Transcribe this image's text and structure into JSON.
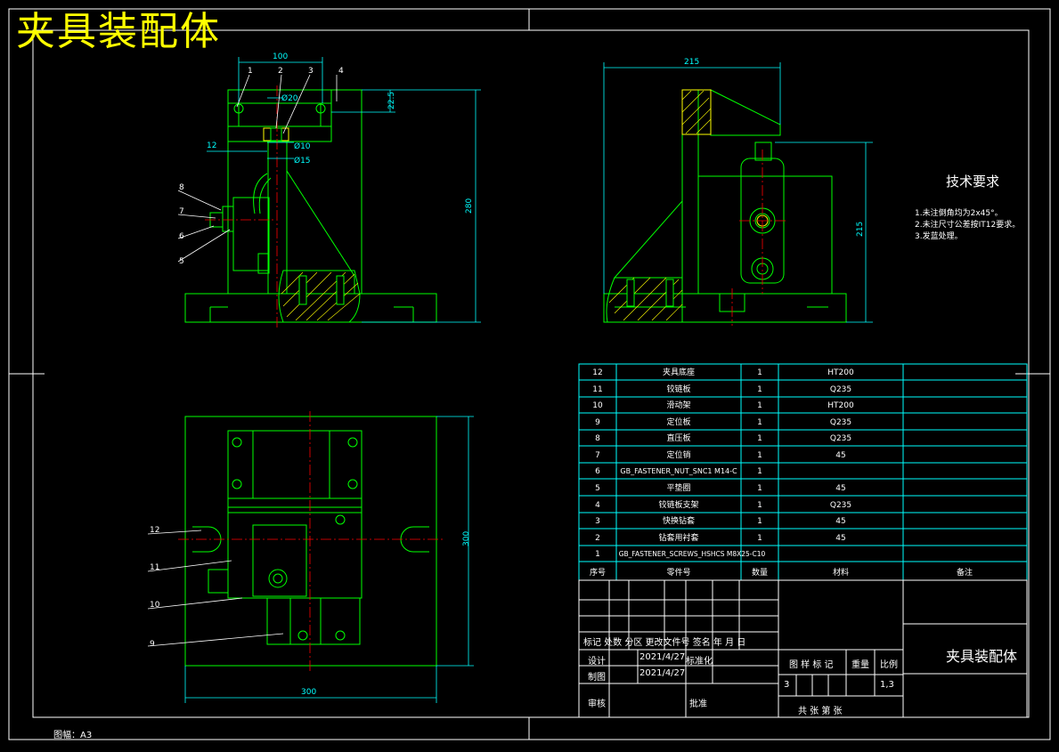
{
  "drawing": {
    "title": "夹具装配体",
    "paper_size_label": "图幅：A3",
    "tech_requirements": {
      "heading": "技术要求",
      "items": [
        "1.未注倒角均为2x45°。",
        "2.未注尺寸公差按IT12要求。",
        "3.发蓝处理。"
      ]
    },
    "colors": {
      "outline": "#00ff00",
      "dimension": "#00ffff",
      "centerline": "#ff0000",
      "leader": "#ffffff",
      "title_text": "#ffff00",
      "border": "#ffffff"
    }
  },
  "front_view": {
    "balloons": [
      "1",
      "2",
      "3",
      "4",
      "8",
      "7",
      "6",
      "5"
    ],
    "dims": {
      "width_top": "100",
      "dia20": "Ø20",
      "h22_5": "22.5",
      "d12": "12",
      "dia10": "Ø10",
      "dia15": "Ø15",
      "height": "280"
    }
  },
  "side_view": {
    "dims": {
      "width_top": "215",
      "height": "215"
    }
  },
  "top_view": {
    "balloons": [
      "12",
      "11",
      "10",
      "9"
    ],
    "dims": {
      "height": "300",
      "width": "300"
    }
  },
  "parts_list": {
    "rows": [
      {
        "no": "12",
        "name": "夹具底座",
        "qty": "1",
        "material": "HT200",
        "note": ""
      },
      {
        "no": "11",
        "name": "铰链板",
        "qty": "1",
        "material": "Q235",
        "note": ""
      },
      {
        "no": "10",
        "name": "滑动架",
        "qty": "1",
        "material": "HT200",
        "note": ""
      },
      {
        "no": "9",
        "name": "定位板",
        "qty": "1",
        "material": "Q235",
        "note": ""
      },
      {
        "no": "8",
        "name": "直压板",
        "qty": "1",
        "material": "Q235",
        "note": ""
      },
      {
        "no": "7",
        "name": "定位销",
        "qty": "1",
        "material": "45",
        "note": ""
      },
      {
        "no": "6",
        "name": "GB_FASTENER_NUT_SNC1 M14-C",
        "qty": "1",
        "material": "",
        "note": ""
      },
      {
        "no": "5",
        "name": "平垫圈",
        "qty": "1",
        "material": "45",
        "note": ""
      },
      {
        "no": "4",
        "name": "铰链板支架",
        "qty": "1",
        "material": "Q235",
        "note": ""
      },
      {
        "no": "3",
        "name": "快换钻套",
        "qty": "1",
        "material": "45",
        "note": ""
      },
      {
        "no": "2",
        "name": "钻套用衬套",
        "qty": "1",
        "material": "45",
        "note": ""
      },
      {
        "no": "1",
        "name": "GB_FASTENER_SCREWS_HSHCS M8X25-C10",
        "qty": "",
        "material": "",
        "note": ""
      }
    ],
    "header": {
      "no": "序号",
      "name": "零件号",
      "qty": "数量",
      "material": "材料",
      "note": "备注"
    }
  },
  "title_block": {
    "rev_header": "标记  处数    分区    更改文件号 签名  年 月 日",
    "design_label": "设计",
    "design_date": "2021/4/27",
    "standardize_label": "标准化",
    "draw_label": "制图",
    "draw_date": "2021/4/27",
    "review_label": "审核",
    "approve_label": "批准",
    "stage_header": "图 样 标 记",
    "weight_label": "重量",
    "scale_label": "比例",
    "stage_value": "3",
    "scale_value": "1,3",
    "sheets_label": "共    张        第    张",
    "drawing_name": "夹具装配体"
  }
}
